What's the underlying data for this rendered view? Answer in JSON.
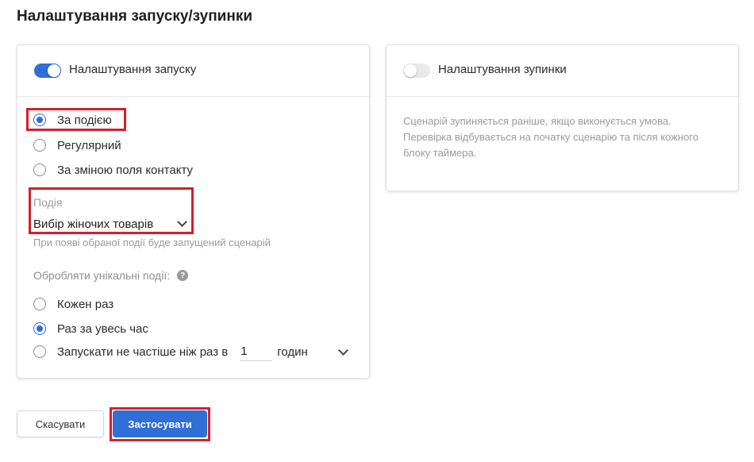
{
  "page": {
    "title": "Налаштування запуску/зупинки"
  },
  "start_panel": {
    "toggle_on": true,
    "label": "Налаштування запуску",
    "trigger_options": [
      {
        "label": "За подією",
        "checked": true
      },
      {
        "label": "Регулярний",
        "checked": false
      },
      {
        "label": "За зміною поля контакту",
        "checked": false
      }
    ],
    "event_field": {
      "label": "Подія",
      "value": "Вибір жіночих товарів",
      "hint": "При появі обраної події буде запущений сценарій"
    },
    "unique_events": {
      "label": "Обробляти унікальні події:",
      "help_icon": "?",
      "options": [
        {
          "label": "Кожен раз",
          "checked": false
        },
        {
          "label": "Раз за увесь час",
          "checked": true
        },
        {
          "label": "Запускати не частіше ніж раз в",
          "checked": false
        }
      ],
      "interval_value": "1",
      "interval_unit": "годин"
    }
  },
  "stop_panel": {
    "toggle_on": false,
    "label": "Налаштування зупинки",
    "description": "Сценарій зупиняється раніше, якщо виконується умова. Перевірка відбувається на початку сценарію та після кожного блоку таймера."
  },
  "buttons": {
    "cancel": "Скасувати",
    "apply": "Застосувати"
  },
  "colors": {
    "accent": "#2f6fd6",
    "highlight": "#d61f2c",
    "muted_text": "#9a9a9a"
  }
}
